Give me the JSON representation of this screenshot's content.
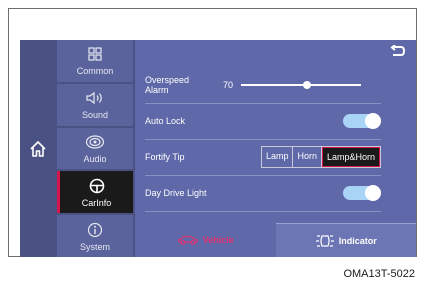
{
  "menu": [
    {
      "label": "Common",
      "icon": "grid-icon",
      "active": false
    },
    {
      "label": "Sound",
      "icon": "speaker-icon",
      "active": false
    },
    {
      "label": "Audio",
      "icon": "audio-icon",
      "active": false
    },
    {
      "label": "CarInfo",
      "icon": "steering-wheel-icon",
      "active": true
    },
    {
      "label": "System",
      "icon": "info-icon",
      "active": false
    }
  ],
  "settings": {
    "overspeed_label": "Overspeed Alarm",
    "overspeed_value": "70",
    "overspeed_level": 0.55,
    "autolock_label": "Auto Lock",
    "autolock_on": true,
    "fortify_label": "Fortify Tip",
    "fortify_options": [
      "Lamp",
      "Horn",
      "Lamp&Horn"
    ],
    "fortify_selected": "Lamp&Horn",
    "daydrive_label": "Day Drive Light",
    "daydrive_on": true
  },
  "tabs": {
    "vehicle": "Vehicle",
    "indicator": "Indicator"
  },
  "caption": "OMA13T-5022",
  "colors": {
    "accent": "#d8154a",
    "toggle": "#a9d4f5",
    "panel": "#5f68a8"
  }
}
